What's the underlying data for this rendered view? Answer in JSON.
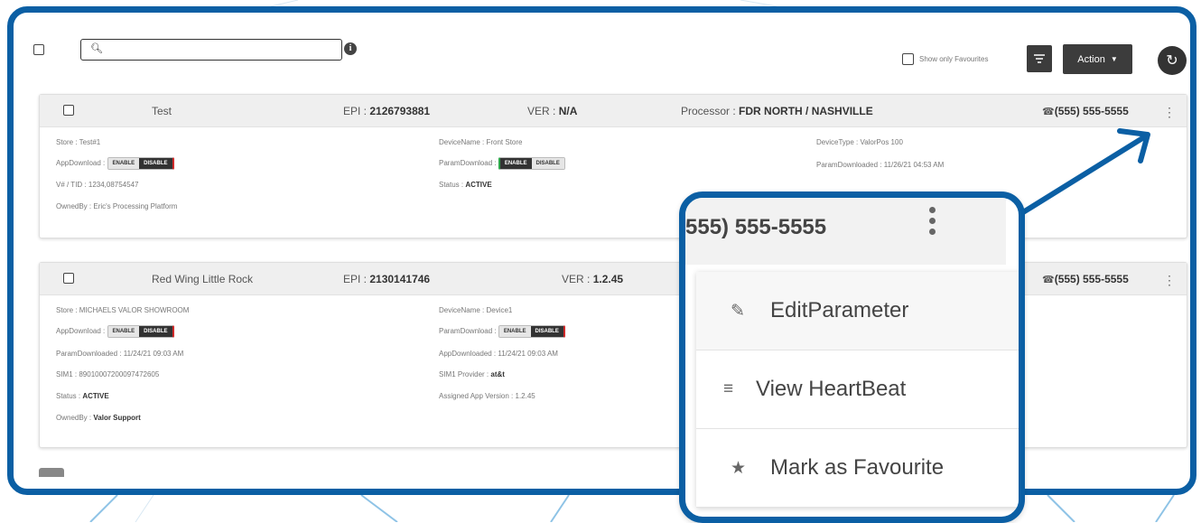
{
  "toolbar": {
    "search_value": "",
    "show_fav_label": "Show only Favourites",
    "action_label": "Action"
  },
  "devices": [
    {
      "name": "Test",
      "epi_label": "EPI :",
      "epi": "2126793881",
      "ver_label": "VER :",
      "ver": "N/A",
      "processor_label": "Processor :",
      "processor": "FDR NORTH / NASHVILLE",
      "phone": "(555) 555-5555",
      "store": "Store : Test#1",
      "device_name": "DeviceName : Front Store",
      "device_type": "DeviceType : ValorPos 100",
      "app_download_label": "AppDownload :",
      "param_download_label": "ParamDownload :",
      "param_downloaded": "ParamDownloaded : 11/26/21 04:53 AM",
      "vtid": "V# / TID : 1234,08754547",
      "status_label": "Status :",
      "status": "ACTIVE",
      "owned_by": "OwnedBy : Eric's Processing Platform"
    },
    {
      "name": "Red Wing Little Rock",
      "epi_label": "EPI :",
      "epi": "2130141746",
      "ver_label": "VER :",
      "ver": "1.2.45",
      "phone": "(555) 555-5555",
      "store": "Store : MICHAELS VALOR SHOWROOM",
      "device_name": "DeviceName : Device1",
      "app_download_label": "AppDownload :",
      "param_download_label": "ParamDownload :",
      "param_downloaded": "ParamDownloaded : 11/24/21 09:03 AM",
      "app_downloaded": "AppDownloaded : 11/24/21 09:03 AM",
      "sim1": "SIM1 : 89010007200097472605",
      "sim1_provider_label": "SIM1 Provider :",
      "sim1_provider": "at&t",
      "status_label": "Status :",
      "status": "ACTIVE",
      "assigned_app_version": "Assigned App Version : 1.2.45",
      "owned_by_label": "OwnedBy :",
      "owned_by": "Valor Support"
    }
  ],
  "toggle": {
    "enable": "ENABLE",
    "disable": "DISABLE"
  },
  "zoom": {
    "phone": "555) 555-5555",
    "menu": [
      {
        "label": "EditParameter",
        "icon": "pencil-icon"
      },
      {
        "label": "View HeartBeat",
        "icon": "list-icon"
      },
      {
        "label": "Mark as Favourite",
        "icon": "star-icon"
      }
    ]
  },
  "colors": {
    "frame_blue": "#0b5fa4",
    "dark_button": "#3c3c3c",
    "enable_green": "#2ea64a",
    "disable_red": "#d12a2a"
  }
}
